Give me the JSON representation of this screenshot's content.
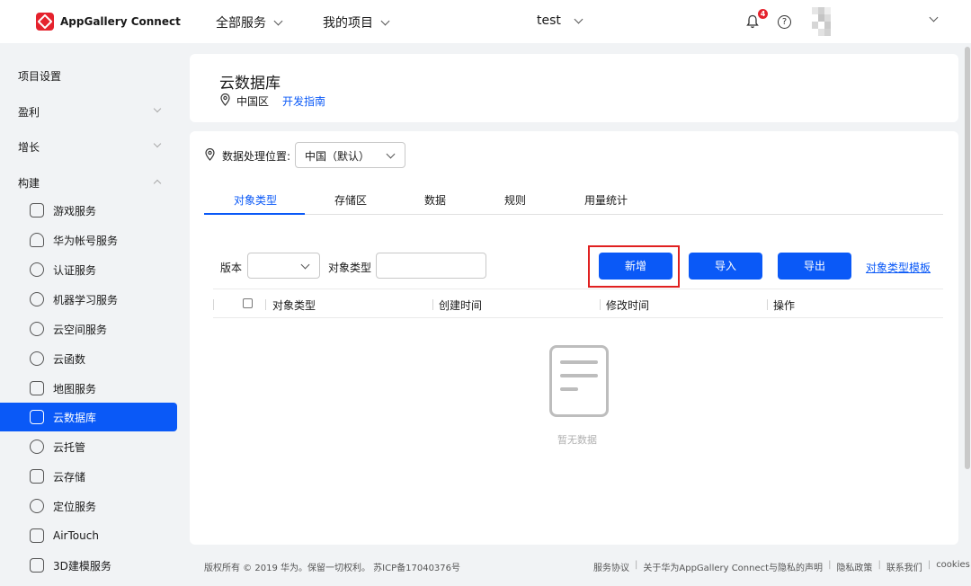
{
  "header": {
    "brand": "AppGallery Connect",
    "nav_all_services": "全部服务",
    "nav_my_projects": "我的项目",
    "project_name": "test",
    "notification_count": "4",
    "help_glyph": "?"
  },
  "sidebar": {
    "project_settings": "项目设置",
    "groups": [
      "盈利",
      "增长",
      "构建"
    ],
    "items": [
      {
        "label": "游戏服务",
        "icon": "gamepad-icon"
      },
      {
        "label": "华为帐号服务",
        "icon": "user-icon"
      },
      {
        "label": "认证服务",
        "icon": "shield-check-icon"
      },
      {
        "label": "机器学习服务",
        "icon": "brain-icon"
      },
      {
        "label": "云空间服务",
        "icon": "cloud-icon"
      },
      {
        "label": "云函数",
        "icon": "cloud-function-icon"
      },
      {
        "label": "地图服务",
        "icon": "map-icon"
      },
      {
        "label": "云数据库",
        "icon": "database-icon"
      },
      {
        "label": "云托管",
        "icon": "globe-icon"
      },
      {
        "label": "云存储",
        "icon": "image-icon"
      },
      {
        "label": "定位服务",
        "icon": "location-icon"
      },
      {
        "label": "AirTouch",
        "icon": "airtouch-icon"
      },
      {
        "label": "3D建模服务",
        "icon": "grid-icon"
      }
    ],
    "active_item": "云数据库"
  },
  "page": {
    "title": "云数据库",
    "region": "中国区",
    "dev_guide": "开发指南"
  },
  "panel": {
    "location_label": "数据处理位置:",
    "location_value": "中国（默认）",
    "tabs": [
      "对象类型",
      "存储区",
      "数据",
      "规则",
      "用量统计"
    ],
    "active_tab": "对象类型",
    "version_label": "版本",
    "version_value": "",
    "object_type_label": "对象类型",
    "object_type_value": "",
    "buttons": {
      "add": "新增",
      "import": "导入",
      "export": "导出"
    },
    "template_link": "对象类型模板",
    "columns": [
      "对象类型",
      "创建时间",
      "修改时间",
      "操作"
    ],
    "empty_text": "暂无数据"
  },
  "footer": {
    "copyright": "版权所有 © 2019 华为。保留一切权利。 苏ICP备17040376号",
    "links": [
      "服务协议",
      "关于华为AppGallery Connect与隐私的声明",
      "隐私政策",
      "联系我们",
      "cookies"
    ]
  },
  "colors": {
    "accent": "#0a59f7",
    "highlight": "#e02020",
    "brand_red": "#e5222d"
  }
}
